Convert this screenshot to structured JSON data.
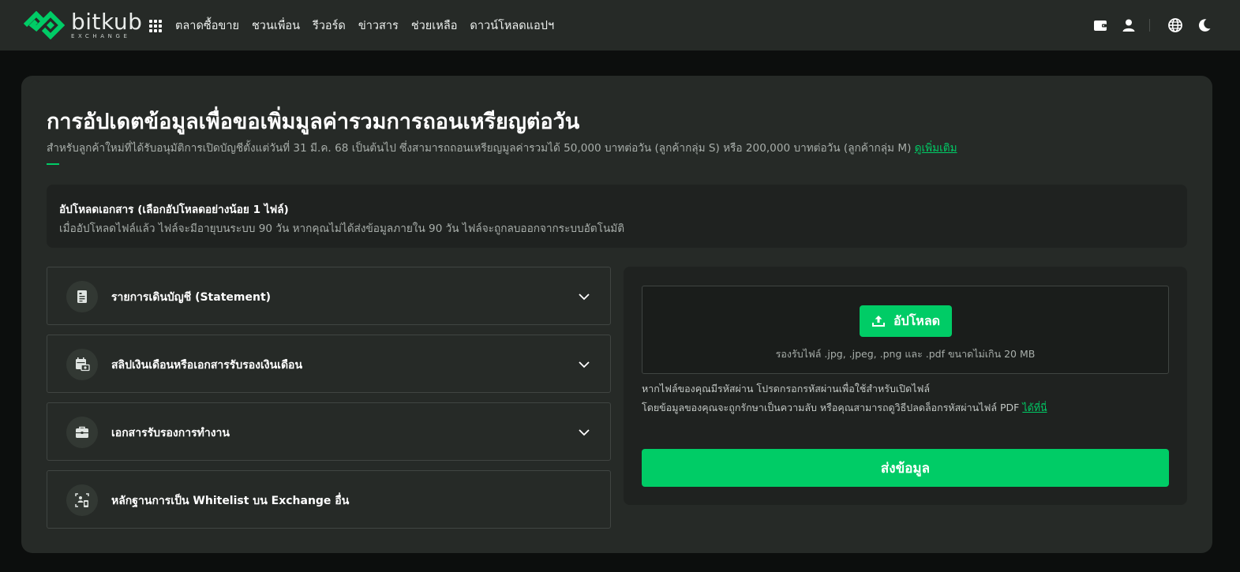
{
  "brand": {
    "name": "bitkub",
    "sub": "EXCHANGE",
    "color": "#00cc66"
  },
  "nav": {
    "items": [
      "ตลาดซื้อขาย",
      "ชวนเพื่อน",
      "รีวอร์ด",
      "ข่าวสาร",
      "ช่วยเหลือ",
      "ดาวน์โหลดแอปฯ"
    ],
    "icons": [
      "apps-grid-icon",
      "wallet-icon",
      "user-icon",
      "globe-icon",
      "moon-icon"
    ]
  },
  "page": {
    "title": "การอัปเดตข้อมูลเพื่อขอเพิ่มมูลค่ารวมการถอนเหรียญต่อวัน",
    "subtitle": "สำหรับลูกค้าใหม่ที่ได้รับอนุมัติการเปิดบัญชีตั้งแต่วันที่ 31 มี.ค. 68 เป็นต้นไป ซึ่งสามารถถอนเหรียญมูลค่ารวมได้ 50,000 บาทต่อวัน (ลูกค้ากลุ่ม S) หรือ 200,000 บาทต่อวัน (ลูกค้ากลุ่ม M)",
    "more_link": "ดูเพิ่มเติม"
  },
  "notice": {
    "title": "อัปโหลดเอกสาร (เลือกอัปโหลดอย่างน้อย 1 ไฟล์)",
    "text": "เมื่ออัปโหลดไฟล์แล้ว ไฟล์จะมีอายุบนระบบ 90 วัน หากคุณไม่ได้ส่งข้อมูลภายใน 90 วัน ไฟล์จะถูกลบออกจากระบบอัตโนมัติ"
  },
  "documents": [
    {
      "label": "รายการเดินบัญชี (Statement)",
      "icon": "statement-icon",
      "expandable": true
    },
    {
      "label": "สลิปเงินเดือนหรือเอกสารรับรองเงินเดือน",
      "icon": "payslip-icon",
      "expandable": true
    },
    {
      "label": "เอกสารรับรองการทำงาน",
      "icon": "briefcase-icon",
      "expandable": true
    },
    {
      "label": "หลักฐานการเป็น Whitelist บน Exchange อื่น",
      "icon": "whitelist-icon",
      "expandable": false
    }
  ],
  "upload": {
    "button_label": "อัปโหลด",
    "hint": "รองรับไฟล์ .jpg, .jpeg, .png และ .pdf ขนาดไม่เกิน 20 MB",
    "password_note_1": "หากไฟล์ของคุณมีรหัสผ่าน โปรดกรอกรหัสผ่านเพื่อใช้สำหรับเปิดไฟล์",
    "password_note_2": "โดยข้อมูลของคุณจะถูกรักษาเป็นความลับ หรือคุณสามารถดูวิธีปลดล็อกรหัสผ่านไฟล์ PDF",
    "here_link": "ได้ที่นี่",
    "submit_label": "ส่งข้อมูล"
  }
}
